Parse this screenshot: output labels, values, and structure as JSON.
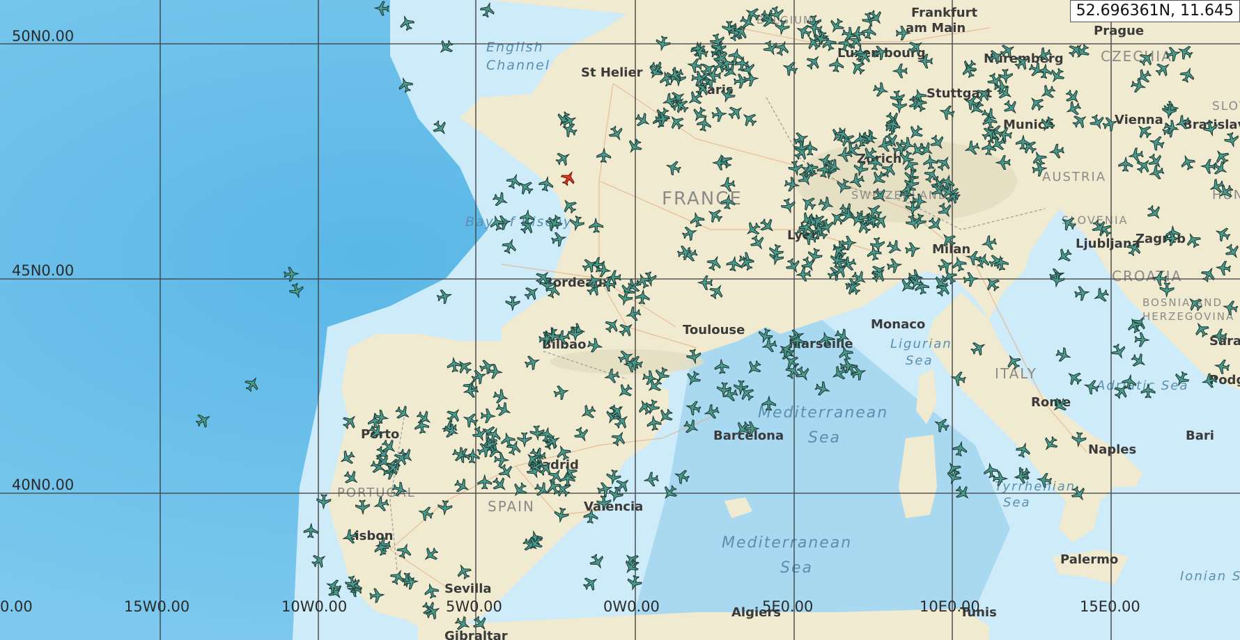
{
  "coordinate_readout": "52.696361N, 11.645",
  "grid": {
    "latitude_labels": [
      "50N0.00",
      "45N0.00",
      "40N0.00"
    ],
    "longitude_labels": [
      "0.00",
      "15W0.00",
      "10W0.00",
      "5W0.00",
      "0W0.00",
      "5E0.00",
      "10E0.00",
      "15E0.00"
    ]
  },
  "countries": [
    "FRANCE",
    "SPAIN",
    "PORTUGAL",
    "ITALY",
    "AUSTRIA",
    "CROATIA",
    "CZECHIA",
    "BOSNIA AND",
    "HERZEGOVINA",
    "SLOVENIA",
    "HUNGARY",
    "SLOVAKIA",
    "BELGIUM",
    "SWITZERLAND"
  ],
  "cities": [
    "Frankfurt",
    "am Main",
    "Prague",
    "Luxembourg",
    "Nuremberg",
    "St Helier",
    "Paris",
    "Stuttgart",
    "Munich",
    "Vienna",
    "Bratislava",
    "Zurich",
    "Lyon",
    "Milan",
    "Ljubljana",
    "Zagreb",
    "Bordeaux",
    "Toulouse",
    "Monaco",
    "Marseille",
    "Bilbao",
    "Barcelona",
    "Porto",
    "Madrid",
    "Valencia",
    "Lisbon",
    "Sevilla",
    "Gibraltar",
    "Rome",
    "Naples",
    "Bari",
    "Sarajevo",
    "Podgorica",
    "Palermo",
    "Algiers",
    "Tunis"
  ],
  "seas": [
    "English",
    "Channel",
    "Bay of Biscay",
    "Mediterranean",
    "Sea",
    "Ligurian",
    "Sea",
    "Adriatic Sea",
    "Tyrrhenian",
    "Sea",
    "Ionian Sea"
  ],
  "colors": {
    "ocean_deep": "#5ab7e6",
    "ocean_shallow": "#cdebf8",
    "land": "#f0ead0",
    "grid": "#3d3d3d",
    "aircraft": "#3f8f82",
    "aircraft_selected": "#e23b22"
  },
  "icons": {
    "aircraft": "airplane-icon",
    "selected_aircraft": "selected-airplane-icon"
  }
}
